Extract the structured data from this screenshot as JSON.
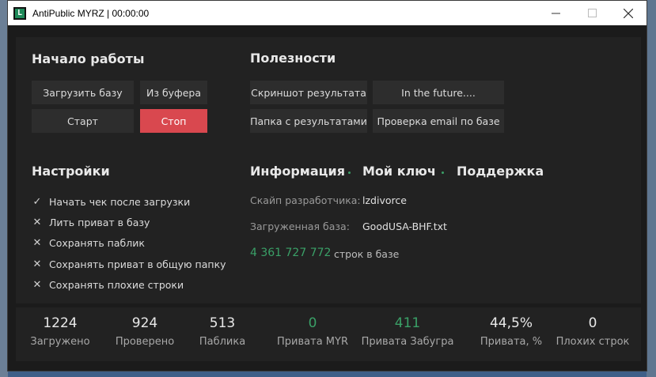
{
  "window": {
    "title": "AntiPublic MYRZ | 00:00:00",
    "icon_glyph": "L",
    "minimize_icon": "minimize-icon",
    "maximize_icon": "maximize-icon",
    "close_icon": "close-icon"
  },
  "start": {
    "heading": "Начало работы",
    "load_db": "Загрузить базу",
    "from_buffer": "Из буфера",
    "start": "Старт",
    "stop": "Стоп"
  },
  "utilities": {
    "heading": "Полезности",
    "screenshot": "Скриншот результата",
    "future": "In the future....",
    "results_folder": "Папка с результатами",
    "check_email": "Проверка email по базе"
  },
  "settings": {
    "heading": "Настройки",
    "options": [
      {
        "label": "Начать чек после загрузки",
        "checked": true
      },
      {
        "label": "Лить приват в базу",
        "checked": false
      },
      {
        "label": "Сохранять паблик",
        "checked": false
      },
      {
        "label": "Сохранять приват в общую папку",
        "checked": false
      },
      {
        "label": "Сохранять плохие строки",
        "checked": false
      }
    ]
  },
  "info": {
    "tab_info": "Информация",
    "tab_key": "Мой ключ",
    "tab_support": "Поддержка",
    "skype_label": "Скайп разработчика:",
    "skype_value": "lzdivorce",
    "db_label": "Загруженная база:",
    "db_value": "GoodUSA-BHF.txt",
    "lines_count": "4 361 727 772",
    "lines_label": "строк в базе"
  },
  "stats": [
    {
      "value": "1224",
      "label": "Загружено",
      "green": false
    },
    {
      "value": "924",
      "label": "Проверено",
      "green": false
    },
    {
      "value": "513",
      "label": "Паблика",
      "green": false
    },
    {
      "value": "0",
      "label": "Привата MYR",
      "green": true
    },
    {
      "value": "411",
      "label": "Привата Забугра",
      "green": true
    },
    {
      "value": "44,5%",
      "label": "Привата, %",
      "green": false
    },
    {
      "value": "0",
      "label": "Плохих строк",
      "green": false
    }
  ],
  "colors": {
    "accent_green": "#3aa067",
    "stop_red": "#d9484f",
    "background": "#1b1b1b",
    "panel": "#222222"
  }
}
